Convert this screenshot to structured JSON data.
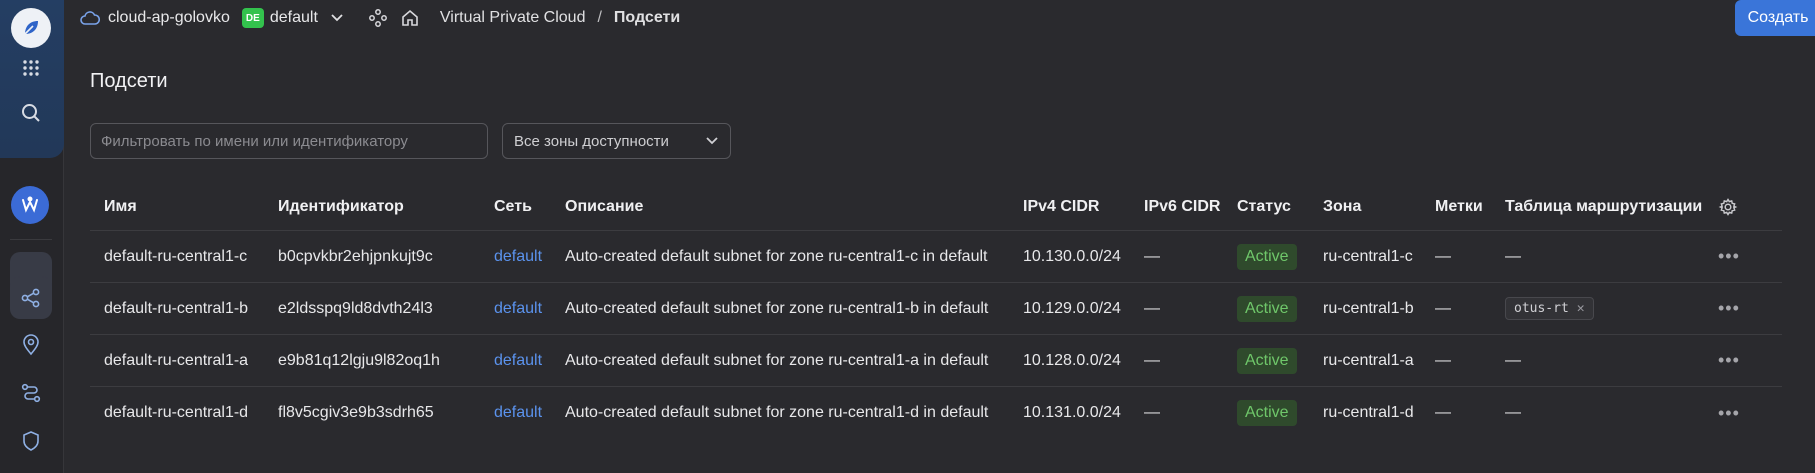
{
  "header": {
    "cloud_name": "cloud-ap-golovko",
    "folder_badge": "DE",
    "folder_name": "default",
    "breadcrumb_service": "Virtual Private Cloud",
    "breadcrumb_separator": "/",
    "breadcrumb_current": "Подсети",
    "create_label": "Создать"
  },
  "page": {
    "title": "Подсети",
    "filter_placeholder": "Фильтровать по имени или идентификатору",
    "zone_select_value": "Все зоны доступности"
  },
  "table": {
    "columns": {
      "name": "Имя",
      "id": "Идентификатор",
      "network": "Сеть",
      "description": "Описание",
      "ipv4": "IPv4 CIDR",
      "ipv6": "IPv6 CIDR",
      "status": "Статус",
      "zone": "Зона",
      "labels": "Метки",
      "route_table": "Таблица маршрутизации"
    },
    "rows": [
      {
        "name": "default-ru-central1-c",
        "id": "b0cpvkbr2ehjpnkujt9c",
        "network": "default",
        "description": "Auto-created default subnet for zone ru-central1-c in default",
        "ipv4": "10.130.0.0/24",
        "ipv6": "—",
        "status": "Active",
        "zone": "ru-central1-c",
        "labels": "—",
        "route_table": "—"
      },
      {
        "name": "default-ru-central1-b",
        "id": "e2ldsspq9ld8dvth24l3",
        "network": "default",
        "description": "Auto-created default subnet for zone ru-central1-b in default",
        "ipv4": "10.129.0.0/24",
        "ipv6": "—",
        "status": "Active",
        "zone": "ru-central1-b",
        "labels": "—",
        "route_table": "otus-rt"
      },
      {
        "name": "default-ru-central1-a",
        "id": "e9b81q12lgju9l82oq1h",
        "network": "default",
        "description": "Auto-created default subnet for zone ru-central1-a in default",
        "ipv4": "10.128.0.0/24",
        "ipv6": "—",
        "status": "Active",
        "zone": "ru-central1-a",
        "labels": "—",
        "route_table": "—"
      },
      {
        "name": "default-ru-central1-d",
        "id": "fl8v5cgiv3e9b3sdrh65",
        "network": "default",
        "description": "Auto-created default subnet for zone ru-central1-d in default",
        "ipv4": "10.131.0.0/24",
        "ipv6": "—",
        "status": "Active",
        "zone": "ru-central1-d",
        "labels": "—",
        "route_table": "—"
      }
    ]
  },
  "icons": {
    "rail": [
      "logo-icon",
      "apps-grid-icon",
      "search-icon",
      "vpc-service-icon",
      "network-topology-icon",
      "subnets-icon",
      "location-pin-icon",
      "routes-icon",
      "shield-icon"
    ],
    "more": "more-horizontal-icon",
    "settings": "gear-icon"
  },
  "colors": {
    "accent": "#3a75d9",
    "link": "#5b93ee",
    "status_active_bg": "#2f4a2c",
    "status_active_text": "#6fc76a",
    "folder_badge": "#33c24d"
  }
}
